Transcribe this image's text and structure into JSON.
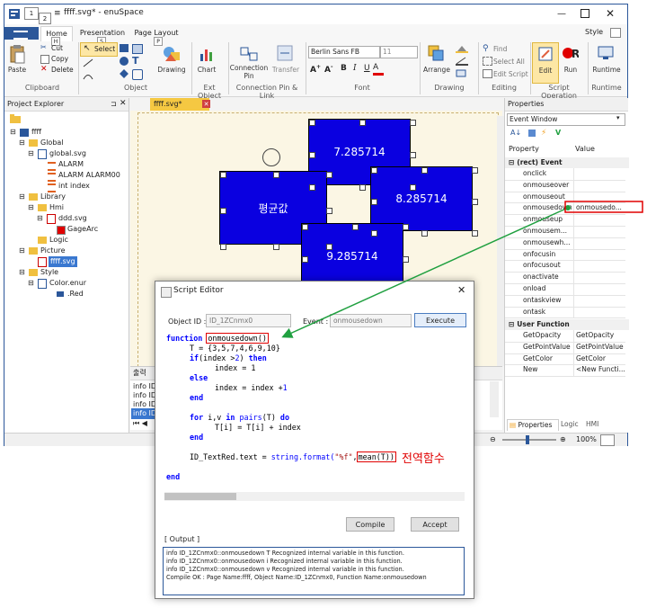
{
  "window": {
    "title": "ffff.svg* - enuSpace",
    "style_label": "Style"
  },
  "quick_access": {
    "badge_1": "1",
    "badge_2": "2"
  },
  "ribbon": {
    "tabs": [
      {
        "label": "Home",
        "key": "H"
      },
      {
        "label": "Presentation",
        "key": "S"
      },
      {
        "label": "Page Layout",
        "key": "P"
      }
    ],
    "clipboard": {
      "paste": "Paste",
      "cut": "Cut",
      "copy": "Copy",
      "delete": "Delete",
      "group": "Clipboard"
    },
    "object": {
      "select": "Select",
      "drawing": "Drawing",
      "group": "Object"
    },
    "ext_object": {
      "chart": "Chart",
      "group": "Ext Object"
    },
    "connection": {
      "pin": "Connection Pin",
      "transfer": "Transfer",
      "group": "Connection Pin & Link"
    },
    "font": {
      "name": "Berlin Sans FB",
      "size": "11",
      "group": "Font"
    },
    "drawing": {
      "arrange": "Arrange",
      "group": "Drawing"
    },
    "editing": {
      "find": "Find",
      "select_all": "Select All",
      "edit_script": "Edit Script",
      "group": "Editing"
    },
    "script_operation": {
      "edit": "Edit",
      "run": "Run",
      "group": "Script Operation"
    },
    "hmi": {
      "runtime": "Runtime",
      "group": "Runtime"
    }
  },
  "project_explorer": {
    "title": "Project Explorer",
    "tree": [
      {
        "label": "ffff",
        "level": 0
      },
      {
        "label": "Global",
        "level": 1
      },
      {
        "label": "global.svg",
        "level": 2
      },
      {
        "label": "ALARM",
        "level": 3
      },
      {
        "label": "ALARM ALARM00",
        "level": 3
      },
      {
        "label": "int index",
        "level": 3
      },
      {
        "label": "Library",
        "level": 1
      },
      {
        "label": "Hmi",
        "level": 2
      },
      {
        "label": "ddd.svg",
        "level": 3
      },
      {
        "label": "GageArc",
        "level": 4
      },
      {
        "label": "Logic",
        "level": 2
      },
      {
        "label": "Picture",
        "level": 1
      },
      {
        "label": "ffff.svg",
        "level": 2
      },
      {
        "label": "Style",
        "level": 1
      },
      {
        "label": "Color.enur",
        "level": 2
      },
      {
        "label": ".Red",
        "level": 3
      }
    ]
  },
  "document_tab": {
    "label": "ffff.svg*"
  },
  "canvas": {
    "shapes": [
      {
        "label": "7.285714"
      },
      {
        "label": "평균값"
      },
      {
        "label": "8.285714"
      },
      {
        "label": "9.285714"
      }
    ]
  },
  "output_panel": {
    "title": "출력",
    "lines": [
      "info ID",
      "info ID",
      "info ID",
      "info ID"
    ]
  },
  "zoom": {
    "value": "100%"
  },
  "properties": {
    "title": "Properties",
    "combo": "Event Window",
    "col_property": "Property",
    "col_value": "Value",
    "section_event": "(rect) Event",
    "events": [
      {
        "name": "onclick",
        "value": ""
      },
      {
        "name": "onmouseover",
        "value": ""
      },
      {
        "name": "onmouseout",
        "value": ""
      },
      {
        "name": "onmousedown",
        "value": "onmousedo..."
      },
      {
        "name": "onmouseup",
        "value": ""
      },
      {
        "name": "onmousem...",
        "value": ""
      },
      {
        "name": "onmousewh...",
        "value": ""
      },
      {
        "name": "onfocusin",
        "value": ""
      },
      {
        "name": "onfocusout",
        "value": ""
      },
      {
        "name": "onactivate",
        "value": ""
      },
      {
        "name": "onload",
        "value": ""
      },
      {
        "name": "ontaskview",
        "value": ""
      },
      {
        "name": "ontask",
        "value": ""
      }
    ],
    "section_user": "User Function",
    "user_functions": [
      {
        "name": "GetOpacity",
        "value": "GetOpacity"
      },
      {
        "name": "GetPointValue",
        "value": "GetPointValue"
      },
      {
        "name": "GetColor",
        "value": "GetColor"
      },
      {
        "name": "New",
        "value": "<New Functi..."
      }
    ],
    "tabs": [
      "Properties",
      "Logic",
      "HMI"
    ]
  },
  "script_editor": {
    "title": "Script Editor",
    "object_id_label": "Object ID :",
    "object_id": "ID_1ZCnmx0",
    "event_label": "Event :",
    "event": "onmousedown",
    "execute": "Execute",
    "code": {
      "l1_kw": "function",
      "l1_name": "onmousedown()",
      "l2": "T = {3,5,7,4,6,9,10}",
      "l3_kw": "if",
      "l3_mid": "(index >",
      "l3_num": "2",
      "l3_end": ")",
      "l3_kw2": "then",
      "l4": "index = 1",
      "l5": "else",
      "l6_pre": "index = index +",
      "l6_num": "1",
      "l7": "end",
      "l8_kw": "for",
      "l8_mid": "i,v",
      "l8_in": "in",
      "l8_pairs": "pairs",
      "l8_arg": "(T)",
      "l8_do": "do",
      "l9": "T[i] = T[i] + index",
      "l10": "end",
      "l11_pre": "ID_TextRed.text =",
      "l11_fn": "string.format(",
      "l11_str": "\"%f\"",
      "l11_comma": ",",
      "l11_mean": "mean(T))",
      "l12": "end"
    },
    "annotation": "전역함수",
    "compile": "Compile",
    "accept": "Accept",
    "output_label": "[ Output ]",
    "output": [
      "info ID_1ZCnmx0::onmousedown T Recognized internal variable in this function.",
      "info ID_1ZCnmx0::onmousedown i Recognized internal variable in this function.",
      "info ID_1ZCnmx0::onmousedown v Recognized internal variable in this function.",
      "Compile OK : Page Name:ffff, Object Name:ID_1ZCnmx0, Function Name:onmousedown"
    ]
  },
  "colors": {
    "accent": "#2b579a",
    "shape_fill": "#0a00e0",
    "highlight": "#e00000",
    "arrow": "#20a040"
  }
}
